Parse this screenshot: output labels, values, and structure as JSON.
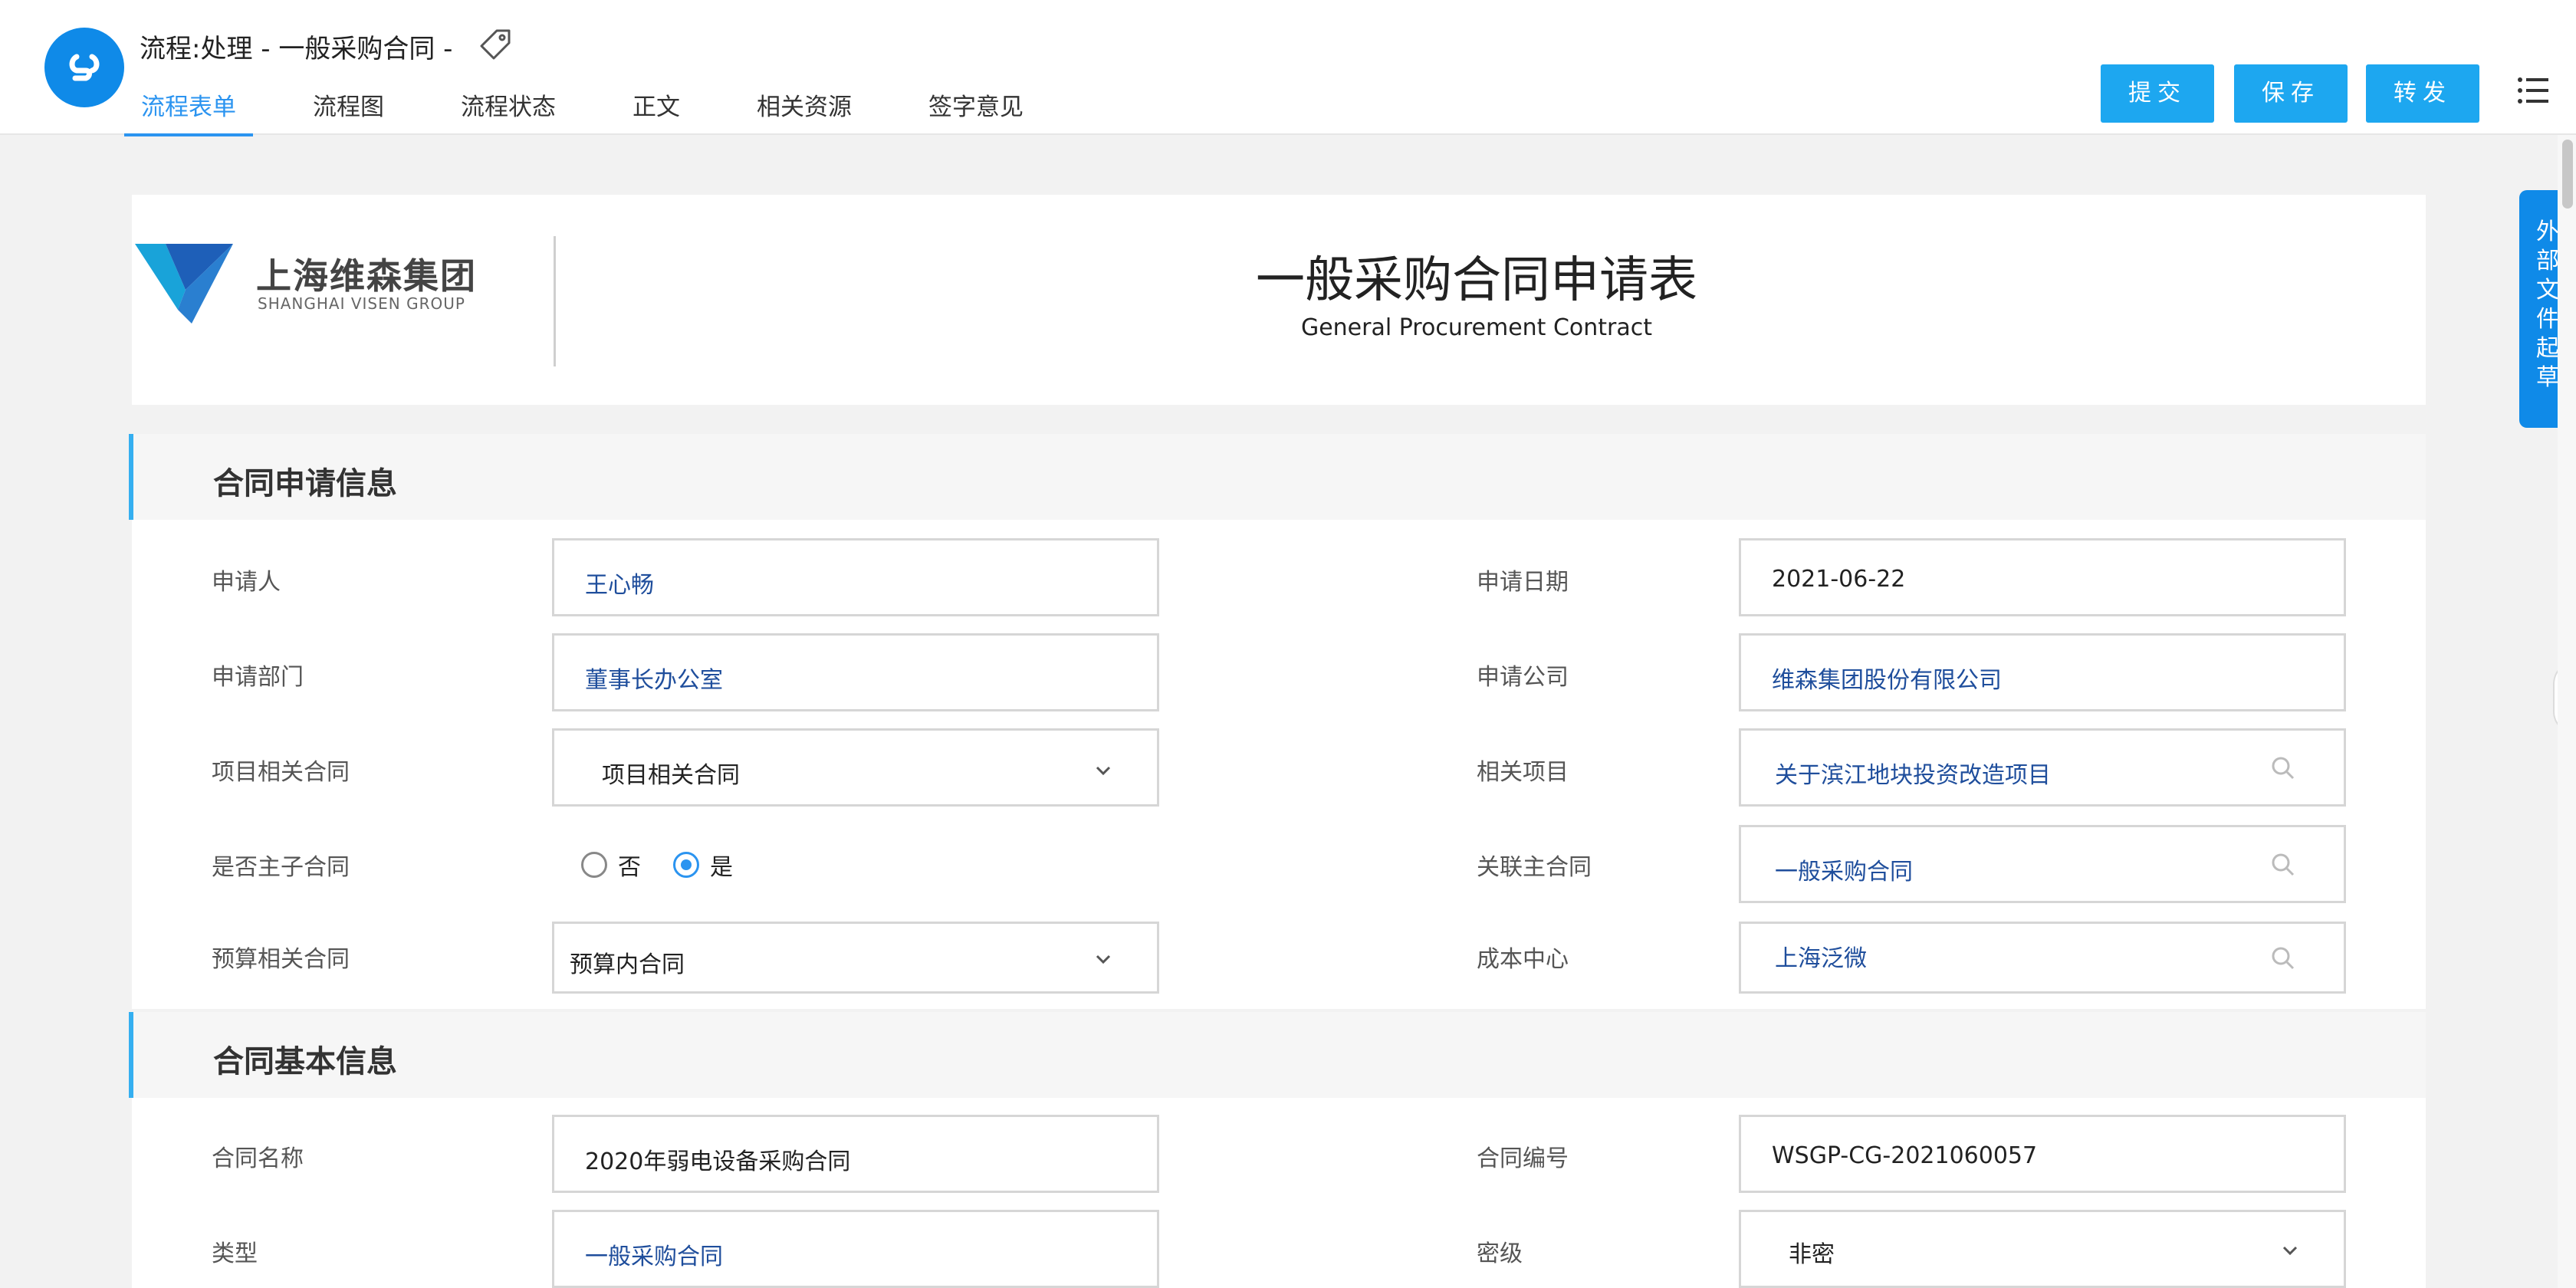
{
  "header": {
    "title": "流程:处理 - 一般采购合同 -",
    "tabs": [
      "流程表单",
      "流程图",
      "流程状态",
      "正文",
      "相关资源",
      "签字意见"
    ],
    "buttons": {
      "submit": "提交",
      "save": "保存",
      "forward": "转发"
    }
  },
  "side_tab": {
    "chars": [
      "外",
      "部",
      "文",
      "件",
      "起",
      "草"
    ]
  },
  "form": {
    "company_cn": "上海维森集团",
    "company_en": "SHANGHAI VISEN GROUP",
    "title": "一般采购合同申请表",
    "subtitle": "General Procurement Contract"
  },
  "section1": {
    "title": "合同申请信息",
    "applicant_label": "申请人",
    "applicant": "王心畅",
    "date_label": "申请日期",
    "date": "2021-06-22",
    "dept_label": "申请部门",
    "dept": "董事长办公室",
    "company_label": "申请公司",
    "company": "维森集团股份有限公司",
    "project_contract_label": "项目相关合同",
    "project_contract": "项目相关合同",
    "related_project_label": "相关项目",
    "related_project": "关于滨江地块投资改造项目",
    "is_master_label": "是否主子合同",
    "radio_no": "否",
    "radio_yes": "是",
    "related_master_label": "关联主合同",
    "related_master": "一般采购合同",
    "budget_label": "预算相关合同",
    "budget": "预算内合同",
    "cost_center_label": "成本中心",
    "cost_center": "上海泛微"
  },
  "section2": {
    "title": "合同基本信息",
    "name_label": "合同名称",
    "name": "2020年弱电设备采购合同",
    "number_label": "合同编号",
    "number": "WSGP-CG-2021060057",
    "type_label": "类型",
    "type": "一般采购合同",
    "secret_label": "密级",
    "secret": "非密"
  },
  "colors": {
    "accent": "#2b94f0",
    "button": "#1da7f0",
    "brand": "#0f8ae8",
    "value_text": "#1f4e9c"
  }
}
